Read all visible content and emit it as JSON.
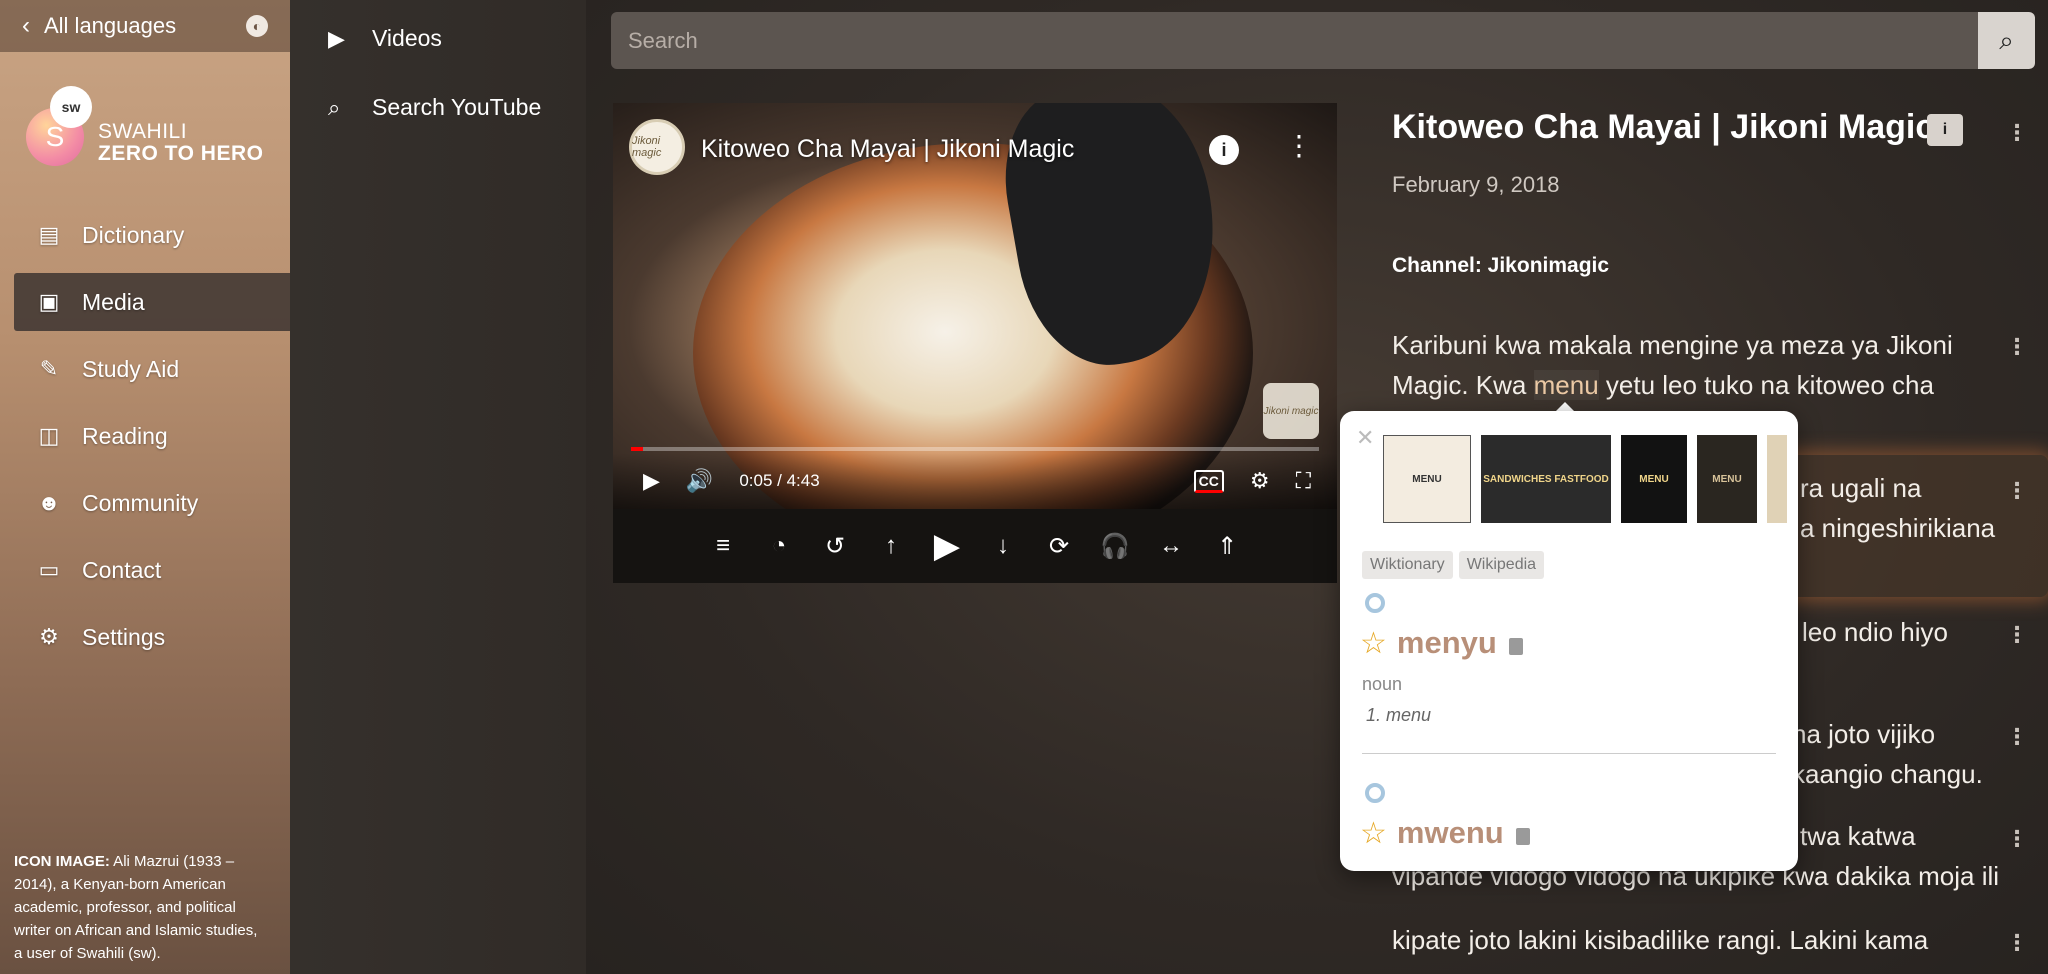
{
  "sidebar": {
    "back_label": "All languages",
    "logo": {
      "badge": "sw",
      "initial": "S",
      "line1": "SWAHILI",
      "line2": "ZERO TO HERO"
    },
    "items": [
      {
        "label": "Dictionary",
        "icon": "book-icon",
        "active": false
      },
      {
        "label": "Media",
        "icon": "photo-icon",
        "active": true
      },
      {
        "label": "Study Aid",
        "icon": "pencil-icon",
        "active": false
      },
      {
        "label": "Reading",
        "icon": "open-book-icon",
        "active": false
      },
      {
        "label": "Community",
        "icon": "users-icon",
        "active": false
      },
      {
        "label": "Contact",
        "icon": "id-card-icon",
        "active": false
      },
      {
        "label": "Settings",
        "icon": "gear-icon",
        "active": false
      }
    ],
    "icon_note_label": "ICON IMAGE:",
    "icon_note_text": " Ali Mazrui (1933 – 2014), a Kenyan-born American academic, professor, and political writer on African and Islamic studies, a user of Swahili (sw)."
  },
  "subnav": {
    "videos": "Videos",
    "search_youtube": "Search YouTube"
  },
  "search": {
    "placeholder": "Search"
  },
  "video": {
    "channel_logo_text": "Jikoni magic",
    "title": "Kitoweo Cha Mayai | Jikoni Magic",
    "time": "0:05 / 4:43",
    "progress_fraction": 0.018,
    "cc_label": "CC"
  },
  "details": {
    "title": "Kitoweo Cha Mayai | Jikoni Magic",
    "date": "February 9, 2018",
    "channel": "Channel: Jikonimagic",
    "p1_before": "Karibuni kwa makala mengine ya meza ya Jikoni Magic. Kwa ",
    "p1_hl": "menu",
    "p1_after": " yetu leo tuko na kitoweo cha",
    "p2_a": "ra ugali na",
    "p2_b": "a ningeshirikiana",
    "p3": "leo ndio hiyo",
    "p4_a": "ha joto vijiko",
    "p4_b": "kaangio changu.",
    "p5_a": "twa katwa",
    "p5_b": "vipande vidogo vidogo na ukipike kwa dakika moja ili",
    "p6": "kipate joto lakini kisibadilike rangi. Lakini kama"
  },
  "popup": {
    "images": [
      "MENU",
      "SANDWICHES FASTFOOD",
      "MENU",
      "MENU"
    ],
    "sources": [
      "Wiktionary",
      "Wikipedia"
    ],
    "entry1": {
      "word": "menyu",
      "pos": "noun",
      "definition": "1. menu"
    },
    "entry2": {
      "word": "mwenu"
    }
  }
}
